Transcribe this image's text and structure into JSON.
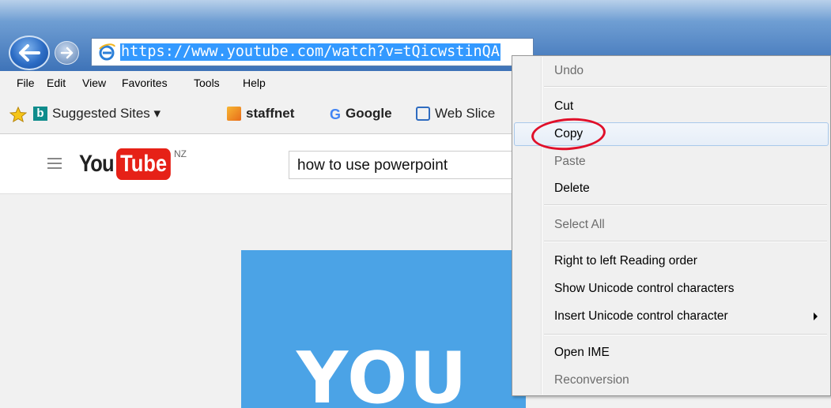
{
  "browser": {
    "url": "https://www.youtube.com/watch?v=tQicwstinQA",
    "menu": [
      "File",
      "Edit",
      "View",
      "Favorites",
      "Tools",
      "Help"
    ],
    "favorites": [
      {
        "label": "Suggested Sites ▾",
        "icon": "bing-icon"
      },
      {
        "label": "staffnet",
        "icon": "staffnet-icon"
      },
      {
        "label": "Google",
        "icon": "google-icon"
      },
      {
        "label": "Web Slice",
        "icon": "web-slice-icon"
      }
    ]
  },
  "youtube": {
    "logo_you": "You",
    "logo_tube": "Tube",
    "region": "NZ",
    "search_value": "how to use powerpoint",
    "thumbnail_text": "YOU"
  },
  "context_menu": {
    "items": [
      {
        "label": "Undo",
        "enabled": false
      },
      {
        "label": "Cut",
        "enabled": true
      },
      {
        "label": "Copy",
        "enabled": true,
        "highlighted": true
      },
      {
        "label": "Paste",
        "enabled": false
      },
      {
        "label": "Delete",
        "enabled": true
      },
      {
        "label": "Select All",
        "enabled": false
      },
      {
        "label": "Right to left Reading order",
        "enabled": true
      },
      {
        "label": "Show Unicode control characters",
        "enabled": true
      },
      {
        "label": "Insert Unicode control character",
        "enabled": true,
        "submenu": true
      },
      {
        "label": "Open IME",
        "enabled": true
      },
      {
        "label": "Reconversion",
        "enabled": false
      }
    ]
  },
  "colors": {
    "selection": "#3399ff",
    "annotation_circle": "#e0102a",
    "youtube_red": "#e62117",
    "thumbnail_blue": "#4ba3e6"
  }
}
